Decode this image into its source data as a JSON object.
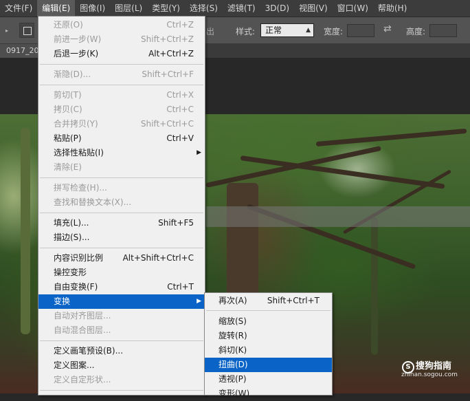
{
  "menubar": {
    "items": [
      "文件(F)",
      "编辑(E)",
      "图像(I)",
      "图层(L)",
      "类型(Y)",
      "选择(S)",
      "滤镜(T)",
      "3D(D)",
      "视图(V)",
      "窗口(W)",
      "帮助(H)"
    ]
  },
  "options": {
    "clipped_text": "出",
    "style_label": "样式:",
    "style_value": "正常",
    "width_label": "宽度:",
    "height_label": "高度:"
  },
  "document": {
    "tab_title": "0917_20"
  },
  "edit_menu": {
    "items": [
      {
        "label": "还原(O)",
        "shortcut": "Ctrl+Z",
        "disabled": true
      },
      {
        "label": "前进一步(W)",
        "shortcut": "Shift+Ctrl+Z",
        "disabled": true
      },
      {
        "label": "后退一步(K)",
        "shortcut": "Alt+Ctrl+Z",
        "disabled": false
      },
      {
        "label": "渐隐(D)...",
        "shortcut": "Shift+Ctrl+F",
        "disabled": true
      },
      {
        "label": "剪切(T)",
        "shortcut": "Ctrl+X",
        "disabled": true
      },
      {
        "label": "拷贝(C)",
        "shortcut": "Ctrl+C",
        "disabled": true
      },
      {
        "label": "合并拷贝(Y)",
        "shortcut": "Shift+Ctrl+C",
        "disabled": true
      },
      {
        "label": "粘贴(P)",
        "shortcut": "Ctrl+V",
        "disabled": false
      },
      {
        "label": "选择性粘贴(I)",
        "shortcut": "",
        "disabled": false
      },
      {
        "label": "清除(E)",
        "shortcut": "",
        "disabled": true
      },
      {
        "label": "拼写检查(H)...",
        "shortcut": "",
        "disabled": true
      },
      {
        "label": "查找和替换文本(X)...",
        "shortcut": "",
        "disabled": true
      },
      {
        "label": "填充(L)...",
        "shortcut": "Shift+F5",
        "disabled": false
      },
      {
        "label": "描边(S)...",
        "shortcut": "",
        "disabled": false
      },
      {
        "label": "内容识别比例",
        "shortcut": "Alt+Shift+Ctrl+C",
        "disabled": false
      },
      {
        "label": "操控变形",
        "shortcut": "",
        "disabled": false
      },
      {
        "label": "自由变换(F)",
        "shortcut": "Ctrl+T",
        "disabled": false
      },
      {
        "label": "变换",
        "shortcut": "",
        "disabled": false,
        "highlighted": true
      },
      {
        "label": "自动对齐图层...",
        "shortcut": "",
        "disabled": true
      },
      {
        "label": "自动混合图层...",
        "shortcut": "",
        "disabled": true
      },
      {
        "label": "定义画笔预设(B)...",
        "shortcut": "",
        "disabled": false
      },
      {
        "label": "定义图案...",
        "shortcut": "",
        "disabled": false
      },
      {
        "label": "定义自定形状...",
        "shortcut": "",
        "disabled": true
      }
    ]
  },
  "transform_menu": {
    "items": [
      {
        "label": "再次(A)",
        "shortcut": "Shift+Ctrl+T"
      },
      {
        "label": "缩放(S)",
        "shortcut": ""
      },
      {
        "label": "旋转(R)",
        "shortcut": ""
      },
      {
        "label": "斜切(K)",
        "shortcut": ""
      },
      {
        "label": "扭曲(D)",
        "shortcut": "",
        "highlighted": true
      },
      {
        "label": "透视(P)",
        "shortcut": ""
      },
      {
        "label": "变形(W)",
        "shortcut": ""
      }
    ]
  },
  "watermark": {
    "brand": "搜狗指南",
    "logo_glyph": "S",
    "url": "zhinan.sogou.com"
  },
  "colors": {
    "menu_highlight": "#0a64c8",
    "menu_bg": "#f0f0f0",
    "app_bg": "#282828",
    "menubar_bg": "#3c3c3c"
  }
}
